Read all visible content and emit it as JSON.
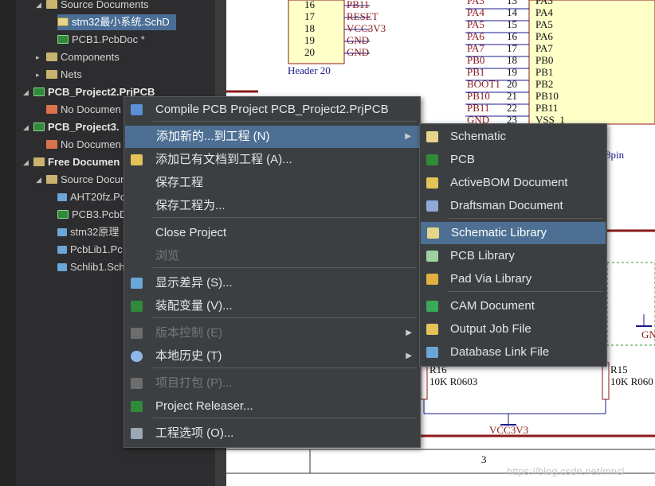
{
  "tree": {
    "items": [
      {
        "label": "Source Documents",
        "indent": 58,
        "icon": "folder",
        "tri": "▲",
        "bold": false,
        "sel": false
      },
      {
        "label": "stm32最小系统.SchD",
        "indent": 72,
        "icon": "sch",
        "tri": "",
        "bold": false,
        "sel": true
      },
      {
        "label": "PCB1.PcbDoc *",
        "indent": 72,
        "icon": "pcb",
        "tri": "",
        "bold": false,
        "sel": false
      },
      {
        "label": "Components",
        "indent": 58,
        "icon": "folder",
        "tri": "▶",
        "bold": false,
        "sel": false
      },
      {
        "label": "Nets",
        "indent": 58,
        "icon": "folder",
        "tri": "▶",
        "bold": false,
        "sel": false
      },
      {
        "label": "PCB_Project2.PrjPCB",
        "indent": 42,
        "icon": "pcb",
        "tri": "▲",
        "bold": true,
        "sel": false
      },
      {
        "label": "No Documen",
        "indent": 58,
        "icon": "folder-red",
        "tri": "",
        "bold": false,
        "sel": false
      },
      {
        "label": "PCB_Project3.",
        "indent": 42,
        "icon": "pcb",
        "tri": "▲",
        "bold": true,
        "sel": false
      },
      {
        "label": "No Documen",
        "indent": 58,
        "icon": "folder-red",
        "tri": "",
        "bold": false,
        "sel": false
      },
      {
        "label": "Free Documen",
        "indent": 42,
        "icon": "folder",
        "tri": "▲",
        "bold": true,
        "sel": false
      },
      {
        "label": "Source Docum",
        "indent": 58,
        "icon": "folder",
        "tri": "▲",
        "bold": false,
        "sel": false
      },
      {
        "label": "AHT20fz.Pc",
        "indent": 72,
        "icon": "lib",
        "tri": "",
        "bold": false,
        "sel": false
      },
      {
        "label": "PCB3.PcbD",
        "indent": 72,
        "icon": "pcb",
        "tri": "",
        "bold": false,
        "sel": false
      },
      {
        "label": "stm32原理",
        "indent": 72,
        "icon": "lib",
        "tri": "",
        "bold": false,
        "sel": false
      },
      {
        "label": "PcbLib1.Pc",
        "indent": 72,
        "icon": "lib",
        "tri": "",
        "bold": false,
        "sel": false
      },
      {
        "label": "Schlib1.Sch",
        "indent": 72,
        "icon": "lib",
        "tri": "",
        "bold": false,
        "sel": false
      }
    ]
  },
  "schematic": {
    "header_pins": [
      {
        "num": "16",
        "net": "PB11"
      },
      {
        "num": "17",
        "net": "RESET"
      },
      {
        "num": "18",
        "net": "VCC3V3"
      },
      {
        "num": "19",
        "net": "GND"
      },
      {
        "num": "20",
        "net": "GND"
      }
    ],
    "header_label": "Header 20",
    "mcu_pins": [
      {
        "net": "PA3",
        "num": "13",
        "name": "PA3"
      },
      {
        "net": "PA4",
        "num": "14",
        "name": "PA4"
      },
      {
        "net": "PA5",
        "num": "15",
        "name": "PA5"
      },
      {
        "net": "PA6",
        "num": "16",
        "name": "PA6"
      },
      {
        "net": "PA7",
        "num": "17",
        "name": "PA7"
      },
      {
        "net": "PB0",
        "num": "18",
        "name": "PB0"
      },
      {
        "net": "PB1",
        "num": "19",
        "name": "PB1"
      },
      {
        "net": "BOOT1",
        "num": "20",
        "name": "PB2"
      },
      {
        "net": "PB10",
        "num": "21",
        "name": "PB10"
      },
      {
        "net": "PB11",
        "num": "22",
        "name": "PB11"
      },
      {
        "net": "GND",
        "num": "23",
        "name": "VSS_1"
      }
    ],
    "pin_suffix": "8pin",
    "r16_label": "R16",
    "r16_value": "10K R0603",
    "r15_label": "R15",
    "r15_value": "10K R060",
    "vcc_label": "VCC3V3",
    "gnd_label": "GN",
    "sheet_number": "3",
    "watermark": "https://blog.csdn.net/mncl"
  },
  "context_menu": {
    "items": [
      {
        "label": "Compile PCB Project PCB_Project2.PrjPCB",
        "icon": "compile-icon",
        "disabled": false,
        "submenu": false,
        "highlight": false
      },
      {
        "label": "添加新的...到工程 (N)",
        "icon": "",
        "disabled": false,
        "submenu": true,
        "highlight": true
      },
      {
        "label": "添加已有文档到工程 (A)...",
        "icon": "add-doc-icon",
        "disabled": false,
        "submenu": false,
        "highlight": false
      },
      {
        "label": "保存工程",
        "icon": "",
        "disabled": false,
        "submenu": false,
        "highlight": false
      },
      {
        "label": "保存工程为...",
        "icon": "",
        "disabled": false,
        "submenu": false,
        "highlight": false
      },
      {
        "label": "Close Project",
        "icon": "",
        "disabled": false,
        "submenu": false,
        "highlight": false
      },
      {
        "label": "浏览",
        "icon": "",
        "disabled": true,
        "submenu": false,
        "highlight": false
      },
      {
        "label": "显示差异 (S)...",
        "icon": "diff-icon",
        "disabled": false,
        "submenu": false,
        "highlight": false
      },
      {
        "label": "装配变量 (V)...",
        "icon": "variant-icon",
        "disabled": false,
        "submenu": false,
        "highlight": false
      },
      {
        "label": "版本控制 (E)",
        "icon": "vcs-icon",
        "disabled": true,
        "submenu": true,
        "highlight": false
      },
      {
        "label": "本地历史 (T)",
        "icon": "history-icon",
        "disabled": false,
        "submenu": true,
        "highlight": false
      },
      {
        "label": "项目打包 (P)...",
        "icon": "package-icon",
        "disabled": true,
        "submenu": false,
        "highlight": false
      },
      {
        "label": "Project Releaser...",
        "icon": "releaser-icon",
        "disabled": false,
        "submenu": false,
        "highlight": false
      },
      {
        "label": "工程选项 (O)...",
        "icon": "options-icon",
        "disabled": false,
        "submenu": false,
        "highlight": false
      }
    ]
  },
  "submenu": {
    "items": [
      {
        "label": "Schematic",
        "icon": "schematic-icon",
        "highlight": false
      },
      {
        "label": "PCB",
        "icon": "pcb-icon",
        "highlight": false
      },
      {
        "label": "ActiveBOM Document",
        "icon": "bom-icon",
        "highlight": false
      },
      {
        "label": "Draftsman Document",
        "icon": "draftsman-icon",
        "highlight": false
      },
      {
        "label": "Schematic Library",
        "icon": "schlib-icon",
        "highlight": true
      },
      {
        "label": "PCB Library",
        "icon": "pcblib-icon",
        "highlight": false
      },
      {
        "label": "Pad Via Library",
        "icon": "padvia-icon",
        "highlight": false
      },
      {
        "label": "CAM Document",
        "icon": "cam-icon",
        "highlight": false
      },
      {
        "label": "Output Job File",
        "icon": "outjob-icon",
        "highlight": false
      },
      {
        "label": "Database Link File",
        "icon": "dblink-icon",
        "highlight": false
      }
    ]
  }
}
